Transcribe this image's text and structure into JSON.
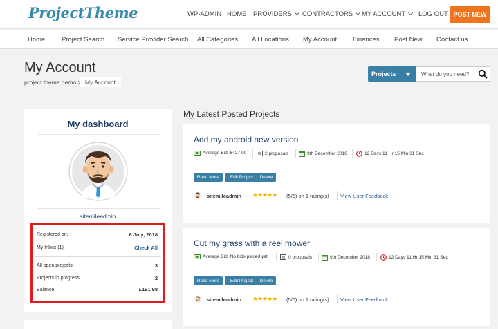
{
  "brand": {
    "logo_text": "ProjectTheme",
    "accent": "#f0741b",
    "primary": "#3a7fa5",
    "title_color": "#1f3f63"
  },
  "topnav": {
    "items": [
      {
        "label": "WP-ADMIN",
        "dropdown": false
      },
      {
        "label": "HOME",
        "dropdown": false
      },
      {
        "label": "PROVIDERS",
        "dropdown": true
      },
      {
        "label": "CONTRACTORS",
        "dropdown": true
      },
      {
        "label": "MY ACCOUNT",
        "dropdown": true
      },
      {
        "label": "LOG OUT",
        "dropdown": false
      }
    ],
    "cta": "POST NEW"
  },
  "subnav": [
    "Home",
    "Project Search",
    "Service Provider Search",
    "All Categories",
    "All Locations",
    "My Account",
    "Finances",
    "Post New",
    "Contact us"
  ],
  "page": {
    "title": "My Account",
    "breadcrumb_home": "project theme demo >",
    "breadcrumb_current": "My Account"
  },
  "search": {
    "select_label": "Projects",
    "placeholder": "What do you need?"
  },
  "dashboard": {
    "title": "My dashboard",
    "username": "sitemileadmin",
    "registered_label": "Registered on:",
    "registered_value": "6 July, 2018",
    "inbox_label": "My Inbox (1):",
    "inbox_action": "Check All",
    "open_label": "All open projects:",
    "open_value": "3",
    "progress_label": "Projects in progress:",
    "progress_value": "2",
    "balance_label": "Balance:",
    "balance_value": "£191.98"
  },
  "projects_section": {
    "title": "My Latest Posted Projects",
    "projects": [
      {
        "title": "Add my android new version",
        "average_bid": "Average Bid: £427.00",
        "proposals": "2 proposals",
        "date": "9th December 2018",
        "time_left": "12 Days 11 Hr 15 Min 31 Sec",
        "owner": "sitemileadmin",
        "rating_stars": 5,
        "rating_text": "(5/5) on 1 rating(s)"
      },
      {
        "title": "Cut my grass with a reel mower",
        "average_bid": "Average Bid: No bids placed yet.",
        "proposals": "0 proposals",
        "date": "9th December 2018",
        "time_left": "12 Days 11 Hr 15 Min 31 Sec",
        "owner": "sitemileadmin",
        "rating_stars": 5,
        "rating_text": "(5/5) on 1 rating(s)"
      }
    ],
    "buttons": {
      "read_more": "Read More",
      "edit": "Edit Project",
      "delete": "Delete"
    },
    "feedback_link": "View User Feedback",
    "stars_text": "★★★★★"
  }
}
